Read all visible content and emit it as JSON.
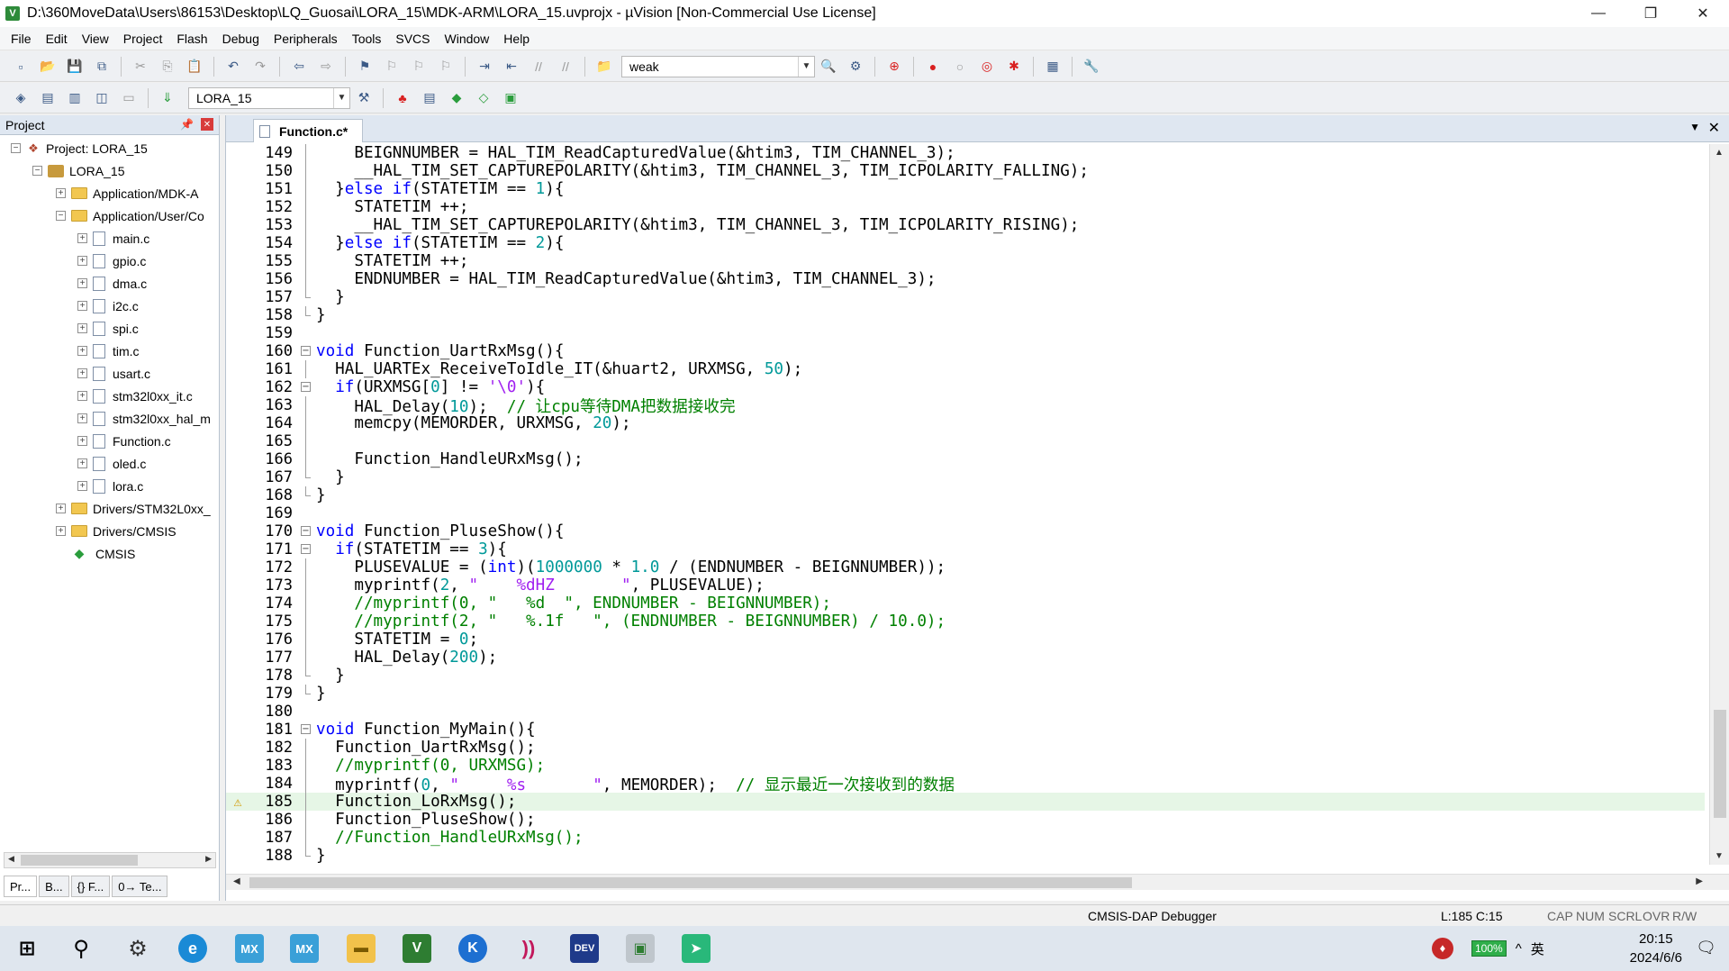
{
  "window": {
    "title": "D:\\360MoveData\\Users\\86153\\Desktop\\LQ_Guosai\\LORA_15\\MDK-ARM\\LORA_15.uvprojx - µVision  [Non-Commercial Use License]",
    "minimize": "—",
    "maximize": "❐",
    "close": "✕"
  },
  "menu": [
    "File",
    "Edit",
    "View",
    "Project",
    "Flash",
    "Debug",
    "Peripherals",
    "Tools",
    "SVCS",
    "Window",
    "Help"
  ],
  "toolbar": {
    "search_value": "weak",
    "target_value": "LORA_15"
  },
  "project_panel": {
    "title": "Project",
    "project_label": "Project: LORA_15",
    "target_label": "LORA_15",
    "groups": [
      {
        "label": "Application/MDK-A",
        "expanded": false
      },
      {
        "label": "Application/User/Co",
        "expanded": true
      }
    ],
    "files": [
      "main.c",
      "gpio.c",
      "dma.c",
      "i2c.c",
      "spi.c",
      "tim.c",
      "usart.c",
      "stm32l0xx_it.c",
      "stm32l0xx_hal_m",
      "Function.c",
      "oled.c",
      "lora.c"
    ],
    "more_groups": [
      "Drivers/STM32L0xx_",
      "Drivers/CMSIS"
    ],
    "cmsis_label": "CMSIS",
    "bottom_tabs": [
      "Pr...",
      "B...",
      "{} F...",
      "0→ Te..."
    ]
  },
  "editor": {
    "tab_label": "Function.c*",
    "lines": [
      {
        "n": "149",
        "fold": "line",
        "segs": [
          {
            "t": "    BEIGNNUMBER = HAL_TIM_ReadCapturedValue(&htim3, TIM_CHANNEL_3);",
            "c": "#000000"
          }
        ]
      },
      {
        "n": "150",
        "fold": "line",
        "segs": [
          {
            "t": "    __HAL_TIM_SET_CAPTUREPOLARITY(&htim3, TIM_CHANNEL_3, TIM_ICPOLARITY_FALLING);",
            "c": "#000000"
          }
        ]
      },
      {
        "n": "151",
        "fold": "line",
        "segs": [
          {
            "t": "  }",
            "c": "#000000"
          },
          {
            "t": "else if",
            "c": "#0000ff"
          },
          {
            "t": "(STATETIM == ",
            "c": "#000000"
          },
          {
            "t": "1",
            "c": "#009999"
          },
          {
            "t": "){",
            "c": "#000000"
          }
        ]
      },
      {
        "n": "152",
        "fold": "line",
        "segs": [
          {
            "t": "    STATETIM ++;",
            "c": "#000000"
          }
        ]
      },
      {
        "n": "153",
        "fold": "line",
        "segs": [
          {
            "t": "    __HAL_TIM_SET_CAPTUREPOLARITY(&htim3, TIM_CHANNEL_3, TIM_ICPOLARITY_RISING);",
            "c": "#000000"
          }
        ]
      },
      {
        "n": "154",
        "fold": "line",
        "segs": [
          {
            "t": "  }",
            "c": "#000000"
          },
          {
            "t": "else if",
            "c": "#0000ff"
          },
          {
            "t": "(STATETIM == ",
            "c": "#000000"
          },
          {
            "t": "2",
            "c": "#009999"
          },
          {
            "t": "){",
            "c": "#000000"
          }
        ]
      },
      {
        "n": "155",
        "fold": "line",
        "segs": [
          {
            "t": "    STATETIM ++;",
            "c": "#000000"
          }
        ]
      },
      {
        "n": "156",
        "fold": "line",
        "segs": [
          {
            "t": "    ENDNUMBER = HAL_TIM_ReadCapturedValue(&htim3, TIM_CHANNEL_3);",
            "c": "#000000"
          }
        ]
      },
      {
        "n": "157",
        "fold": "end",
        "segs": [
          {
            "t": "  }",
            "c": "#000000"
          }
        ]
      },
      {
        "n": "158",
        "fold": "end",
        "segs": [
          {
            "t": "}",
            "c": "#000000"
          }
        ]
      },
      {
        "n": "159",
        "fold": "",
        "segs": [
          {
            "t": "",
            "c": "#000000"
          }
        ]
      },
      {
        "n": "160",
        "fold": "box",
        "segs": [
          {
            "t": "void",
            "c": "#0000ff"
          },
          {
            "t": " Function_UartRxMsg(){",
            "c": "#000000"
          }
        ]
      },
      {
        "n": "161",
        "fold": "line",
        "segs": [
          {
            "t": "  HAL_UARTEx_ReceiveToIdle_IT(&huart2, URXMSG, ",
            "c": "#000000"
          },
          {
            "t": "50",
            "c": "#009999"
          },
          {
            "t": ");",
            "c": "#000000"
          }
        ]
      },
      {
        "n": "162",
        "fold": "box",
        "segs": [
          {
            "t": "  ",
            "c": "#000000"
          },
          {
            "t": "if",
            "c": "#0000ff"
          },
          {
            "t": "(URXMSG[",
            "c": "#000000"
          },
          {
            "t": "0",
            "c": "#009999"
          },
          {
            "t": "] != ",
            "c": "#000000"
          },
          {
            "t": "'\\0'",
            "c": "#a020f0"
          },
          {
            "t": "){",
            "c": "#000000"
          }
        ]
      },
      {
        "n": "163",
        "fold": "line",
        "segs": [
          {
            "t": "    HAL_Delay(",
            "c": "#000000"
          },
          {
            "t": "10",
            "c": "#009999"
          },
          {
            "t": ");  ",
            "c": "#000000"
          },
          {
            "t": "// 让cpu等待DMA把数据接收完",
            "c": "#008000"
          }
        ]
      },
      {
        "n": "164",
        "fold": "line",
        "segs": [
          {
            "t": "    memcpy(MEMORDER, URXMSG, ",
            "c": "#000000"
          },
          {
            "t": "20",
            "c": "#009999"
          },
          {
            "t": ");",
            "c": "#000000"
          }
        ]
      },
      {
        "n": "165",
        "fold": "line",
        "segs": [
          {
            "t": "",
            "c": "#000000"
          }
        ]
      },
      {
        "n": "166",
        "fold": "line",
        "segs": [
          {
            "t": "    Function_HandleURxMsg();",
            "c": "#000000"
          }
        ]
      },
      {
        "n": "167",
        "fold": "end",
        "segs": [
          {
            "t": "  }",
            "c": "#000000"
          }
        ]
      },
      {
        "n": "168",
        "fold": "end",
        "segs": [
          {
            "t": "}",
            "c": "#000000"
          }
        ]
      },
      {
        "n": "169",
        "fold": "",
        "segs": [
          {
            "t": "",
            "c": "#000000"
          }
        ]
      },
      {
        "n": "170",
        "fold": "box",
        "segs": [
          {
            "t": "void",
            "c": "#0000ff"
          },
          {
            "t": " Function_PluseShow(){",
            "c": "#000000"
          }
        ]
      },
      {
        "n": "171",
        "fold": "box",
        "segs": [
          {
            "t": "  ",
            "c": "#000000"
          },
          {
            "t": "if",
            "c": "#0000ff"
          },
          {
            "t": "(STATETIM == ",
            "c": "#000000"
          },
          {
            "t": "3",
            "c": "#009999"
          },
          {
            "t": "){",
            "c": "#000000"
          }
        ]
      },
      {
        "n": "172",
        "fold": "line",
        "segs": [
          {
            "t": "    PLUSEVALUE = (",
            "c": "#000000"
          },
          {
            "t": "int",
            "c": "#0000ff"
          },
          {
            "t": ")(",
            "c": "#000000"
          },
          {
            "t": "1000000",
            "c": "#009999"
          },
          {
            "t": " * ",
            "c": "#000000"
          },
          {
            "t": "1.0",
            "c": "#009999"
          },
          {
            "t": " / (ENDNUMBER - BEIGNNUMBER));",
            "c": "#000000"
          }
        ]
      },
      {
        "n": "173",
        "fold": "line",
        "segs": [
          {
            "t": "    myprintf(",
            "c": "#000000"
          },
          {
            "t": "2",
            "c": "#009999"
          },
          {
            "t": ", ",
            "c": "#000000"
          },
          {
            "t": "\"    %dHZ       \"",
            "c": "#a020f0"
          },
          {
            "t": ", PLUSEVALUE);",
            "c": "#000000"
          }
        ]
      },
      {
        "n": "174",
        "fold": "line",
        "segs": [
          {
            "t": "    //myprintf(0, \"   %d  \", ENDNUMBER - BEIGNNUMBER);",
            "c": "#008000"
          }
        ]
      },
      {
        "n": "175",
        "fold": "line",
        "segs": [
          {
            "t": "    //myprintf(2, \"   %.1f   \", (ENDNUMBER - BEIGNNUMBER) / 10.0);",
            "c": "#008000"
          }
        ]
      },
      {
        "n": "176",
        "fold": "line",
        "segs": [
          {
            "t": "    STATETIM = ",
            "c": "#000000"
          },
          {
            "t": "0",
            "c": "#009999"
          },
          {
            "t": ";",
            "c": "#000000"
          }
        ]
      },
      {
        "n": "177",
        "fold": "line",
        "segs": [
          {
            "t": "    HAL_Delay(",
            "c": "#000000"
          },
          {
            "t": "200",
            "c": "#009999"
          },
          {
            "t": ");",
            "c": "#000000"
          }
        ]
      },
      {
        "n": "178",
        "fold": "end",
        "segs": [
          {
            "t": "  }",
            "c": "#000000"
          }
        ]
      },
      {
        "n": "179",
        "fold": "end",
        "segs": [
          {
            "t": "}",
            "c": "#000000"
          }
        ]
      },
      {
        "n": "180",
        "fold": "",
        "segs": [
          {
            "t": "",
            "c": "#000000"
          }
        ]
      },
      {
        "n": "181",
        "fold": "box",
        "segs": [
          {
            "t": "void",
            "c": "#0000ff"
          },
          {
            "t": " Function_MyMain(){",
            "c": "#000000"
          }
        ]
      },
      {
        "n": "182",
        "fold": "line",
        "segs": [
          {
            "t": "  Function_UartRxMsg();",
            "c": "#000000"
          }
        ]
      },
      {
        "n": "183",
        "fold": "line",
        "segs": [
          {
            "t": "  //myprintf(0, URXMSG);",
            "c": "#008000"
          }
        ]
      },
      {
        "n": "184",
        "fold": "line",
        "segs": [
          {
            "t": "  myprintf(",
            "c": "#000000"
          },
          {
            "t": "0",
            "c": "#009999"
          },
          {
            "t": ", ",
            "c": "#000000"
          },
          {
            "t": "\"     %s       \"",
            "c": "#a020f0"
          },
          {
            "t": ", MEMORDER);  ",
            "c": "#000000"
          },
          {
            "t": "// 显示最近一次接收到的数据",
            "c": "#008000"
          }
        ]
      },
      {
        "n": "185",
        "fold": "line",
        "mark": "⚠",
        "highlight": true,
        "segs": [
          {
            "t": "  Function_LoRxMsg();",
            "c": "#000000"
          }
        ]
      },
      {
        "n": "186",
        "fold": "line",
        "segs": [
          {
            "t": "  Function_PluseShow();",
            "c": "#000000"
          }
        ]
      },
      {
        "n": "187",
        "fold": "line",
        "segs": [
          {
            "t": "  //Function_HandleURxMsg();",
            "c": "#008000"
          }
        ]
      },
      {
        "n": "188",
        "fold": "end",
        "segs": [
          {
            "t": "}",
            "c": "#000000"
          }
        ]
      }
    ]
  },
  "status": {
    "debugger": "CMSIS-DAP Debugger",
    "position": "L:185 C:15",
    "cap": "CAP",
    "num": "NUM",
    "scrl": "SCRL",
    "ovr": "OVR",
    "rw": "R/W"
  },
  "taskbar": {
    "apps": [
      "start-icon",
      "search-icon",
      "settings-icon",
      "edge-icon",
      "cubemx-icon",
      "cubemx2-icon",
      "explorer-icon",
      "keil-icon",
      "kodi-icon",
      "rss-icon",
      "devcpp-icon",
      "app-icon",
      "feishu-icon"
    ],
    "app_labels": [
      "MX",
      "MX",
      "DEV"
    ],
    "battery": "100%",
    "ime": "英",
    "time": "20:15",
    "date": "2024/6/6"
  }
}
